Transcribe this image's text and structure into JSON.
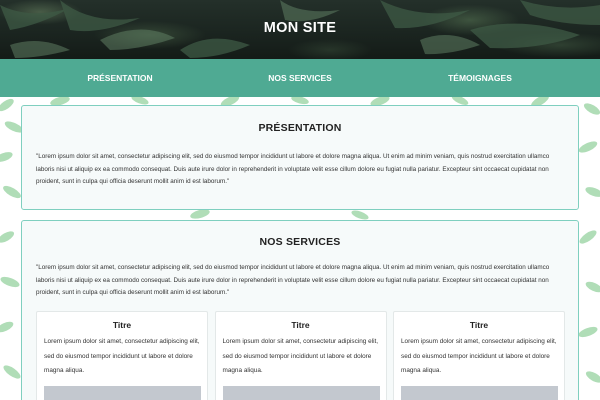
{
  "header": {
    "title": "MON SITE"
  },
  "nav": {
    "items": [
      "PRÉSENTATION",
      "NOS SERVICES",
      "TÉMOIGNAGES"
    ]
  },
  "presentation": {
    "title": "PRÉSENTATION",
    "text": "\"Lorem ipsum dolor sit amet, consectetur adipiscing elit, sed do eiusmod tempor incididunt ut labore et dolore magna aliqua. Ut enim ad minim veniam, quis nostrud exercitation ullamco laboris nisi ut aliquip ex ea commodo consequat. Duis aute irure dolor in reprehenderit in voluptate velit esse cillum dolore eu fugiat nulla pariatur. Excepteur sint occaecat cupidatat non proident, sunt in culpa qui officia deserunt mollit anim id est laborum.\""
  },
  "services": {
    "title": "NOS SERVICES",
    "text": "\"Lorem ipsum dolor sit amet, consectetur adipiscing elit, sed do eiusmod tempor incididunt ut labore et dolore magna aliqua. Ut enim ad minim veniam, quis nostrud exercitation ullamco laboris nisi ut aliquip ex ea commodo consequat. Duis aute irure dolor in reprehenderit in voluptate velit esse cillum dolore eu fugiat nulla pariatur. Excepteur sint occaecat cupidatat non proident, sunt in culpa qui officia deserunt mollit anim id est laborum.\"",
    "cards": [
      {
        "title": "Titre",
        "text": "Lorem ipsum dolor sit amet, consectetur adipiscing elit, sed do eiusmod tempor incididunt ut labore et dolore magna aliqua."
      },
      {
        "title": "Titre",
        "text": "Lorem ipsum dolor sit amet, consectetur adipiscing elit, sed do eiusmod tempor incididunt ut labore et dolore magna aliqua."
      },
      {
        "title": "Titre",
        "text": "Lorem ipsum dolor sit amet, consectetur adipiscing elit, sed do eiusmod tempor incididunt ut labore et dolore magna aliqua."
      }
    ]
  },
  "colors": {
    "nav_background": "#4faa93",
    "card_border": "#7fcfbf",
    "banner_dark": "#1b2520",
    "image_placeholder": "#c3c8cf"
  }
}
